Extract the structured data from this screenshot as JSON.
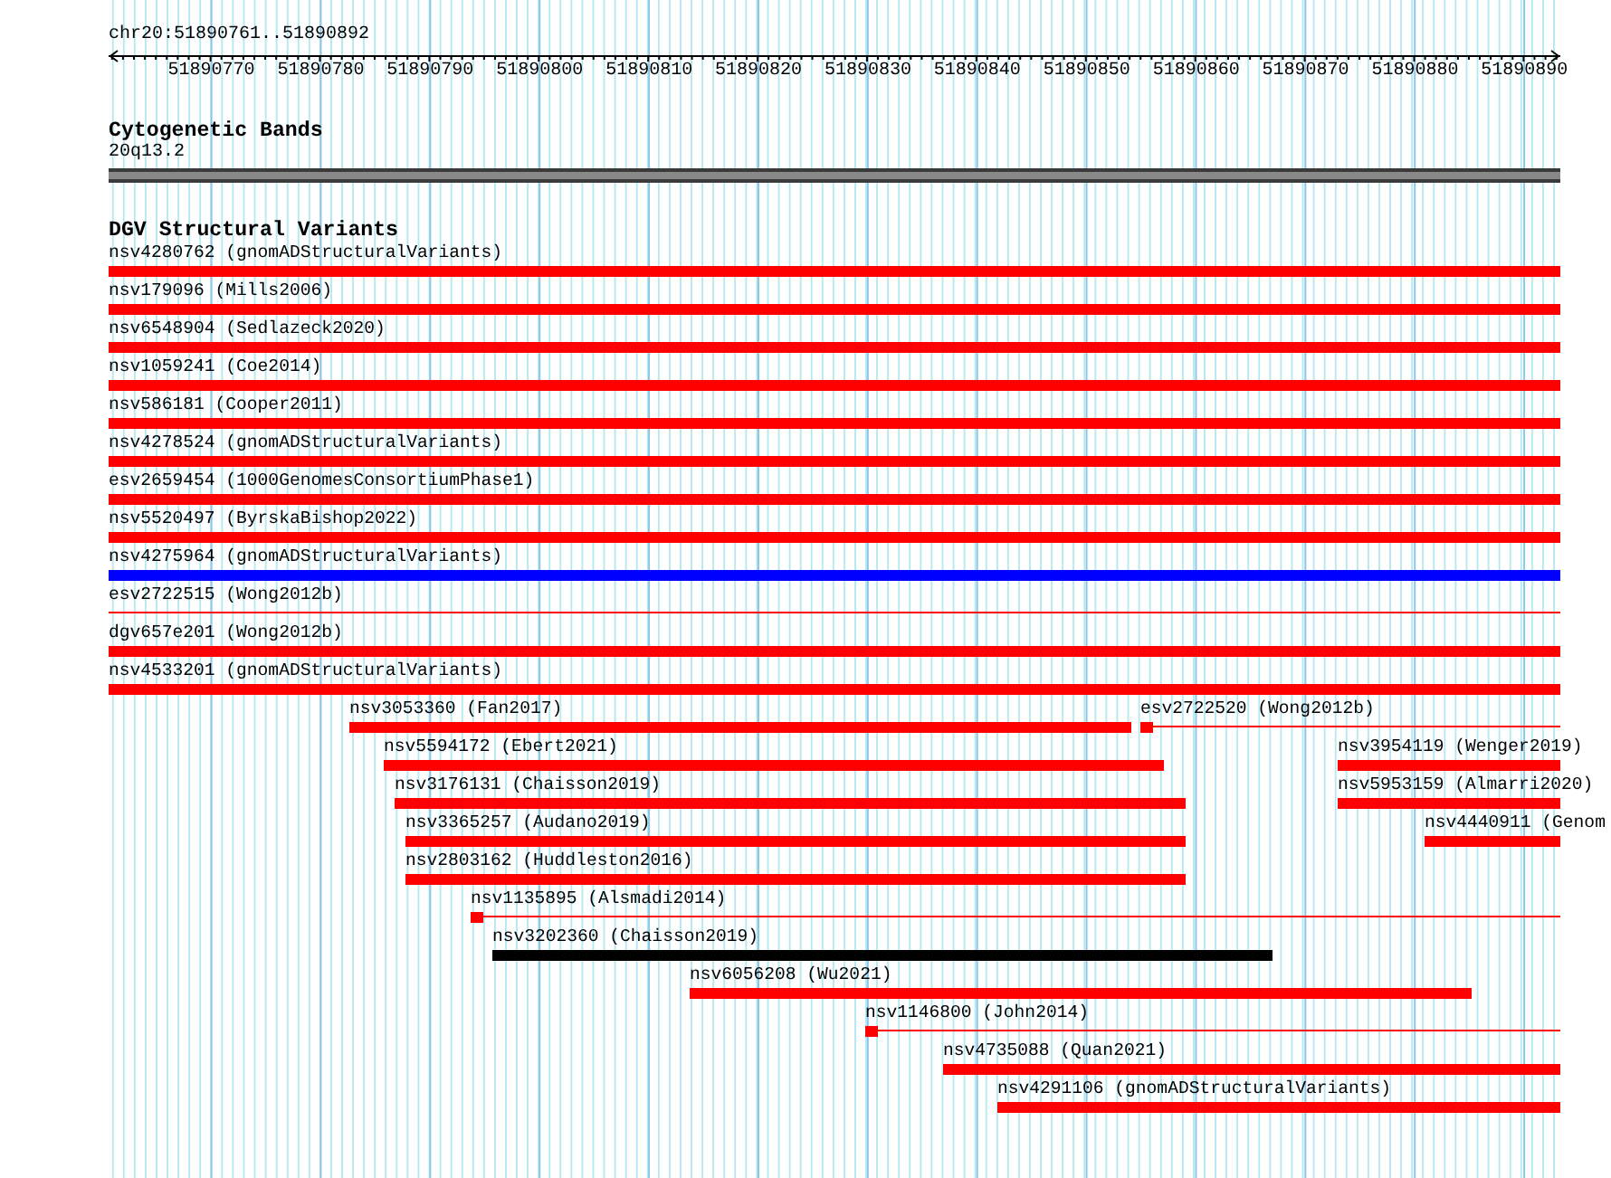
{
  "position": "chr20:51890761..51890892",
  "ruler": {
    "ticks": [
      "51890770",
      "51890780",
      "51890790",
      "51890800",
      "51890810",
      "51890820",
      "51890830",
      "51890840",
      "51890850",
      "51890860",
      "51890870",
      "51890880",
      "51890890"
    ]
  },
  "cytogenetic_bands": {
    "title": "Cytogenetic Bands",
    "band": "20q13.2"
  },
  "dgv_track": {
    "title": "DGV Structural Variants",
    "rows": [
      {
        "features": [
          {
            "label": "nsv4280762 (gnomADStructuralVariants)",
            "kind": "bar",
            "color": "#ff0000"
          }
        ]
      },
      {
        "features": [
          {
            "label": "nsv179096 (Mills2006)",
            "kind": "bar",
            "color": "#ff0000"
          }
        ]
      },
      {
        "features": [
          {
            "label": "nsv6548904 (Sedlazeck2020)",
            "kind": "bar",
            "color": "#ff0000"
          }
        ]
      },
      {
        "features": [
          {
            "label": "nsv1059241 (Coe2014)",
            "kind": "bar",
            "color": "#ff0000"
          }
        ]
      },
      {
        "features": [
          {
            "label": "nsv586181 (Cooper2011)",
            "kind": "bar",
            "color": "#ff0000"
          }
        ]
      },
      {
        "features": [
          {
            "label": "nsv4278524 (gnomADStructuralVariants)",
            "kind": "bar",
            "color": "#ff0000"
          }
        ]
      },
      {
        "features": [
          {
            "label": "esv2659454 (1000GenomesConsortiumPhase1)",
            "kind": "bar",
            "color": "#ff0000"
          }
        ]
      },
      {
        "features": [
          {
            "label": "nsv5520497 (ByrskaBishop2022)",
            "kind": "bar",
            "color": "#ff0000"
          }
        ]
      },
      {
        "features": [
          {
            "label": "nsv4275964 (gnomADStructuralVariants)",
            "kind": "bar",
            "color": "#0000ff"
          }
        ]
      },
      {
        "features": [
          {
            "label": "esv2722515 (Wong2012b)",
            "kind": "line",
            "color": "#ff0000"
          }
        ]
      },
      {
        "features": [
          {
            "label": "dgv657e201 (Wong2012b)",
            "kind": "bar",
            "color": "#ff0000"
          }
        ]
      },
      {
        "features": [
          {
            "label": "nsv4533201 (gnomADStructuralVariants)",
            "kind": "bar",
            "color": "#ff0000"
          }
        ]
      },
      {
        "features": [
          {
            "label": "nsv3053360 (Fan2017)",
            "kind": "bar",
            "color": "#ff0000"
          },
          {
            "label": "esv2722520 (Wong2012b)",
            "kind": "block-line",
            "color": "#ff0000"
          }
        ]
      },
      {
        "features": [
          {
            "label": "nsv5594172 (Ebert2021)",
            "kind": "bar",
            "color": "#ff0000"
          },
          {
            "label": "nsv3954119 (Wenger2019)",
            "kind": "bar",
            "color": "#ff0000"
          }
        ]
      },
      {
        "features": [
          {
            "label": "nsv3176131 (Chaisson2019)",
            "kind": "bar",
            "color": "#ff0000"
          },
          {
            "label": "nsv5953159 (Almarri2020)",
            "kind": "bar",
            "color": "#ff0000"
          }
        ]
      },
      {
        "features": [
          {
            "label": "nsv3365257 (Audano2019)",
            "kind": "bar",
            "color": "#ff0000"
          },
          {
            "label": "nsv4440911 (Genom",
            "kind": "bar",
            "color": "#ff0000"
          }
        ]
      },
      {
        "features": [
          {
            "label": "nsv2803162 (Huddleston2016)",
            "kind": "bar",
            "color": "#ff0000"
          }
        ]
      },
      {
        "features": [
          {
            "label": "nsv1135895 (Alsmadi2014)",
            "kind": "block-line",
            "color": "#ff0000"
          }
        ]
      },
      {
        "features": [
          {
            "label": "nsv3202360 (Chaisson2019)",
            "kind": "bar",
            "color": "#000000"
          }
        ]
      },
      {
        "features": [
          {
            "label": "nsv6056208 (Wu2021)",
            "kind": "bar",
            "color": "#ff0000"
          }
        ]
      },
      {
        "features": [
          {
            "label": "nsv1146800 (John2014)",
            "kind": "block-line",
            "color": "#ff0000"
          }
        ]
      },
      {
        "features": [
          {
            "label": "nsv4735088 (Quan2021)",
            "kind": "bar",
            "color": "#ff0000"
          }
        ]
      },
      {
        "features": [
          {
            "label": "nsv4291106 (gnomADStructuralVariants)",
            "kind": "bar",
            "color": "#ff0000"
          }
        ]
      }
    ]
  }
}
